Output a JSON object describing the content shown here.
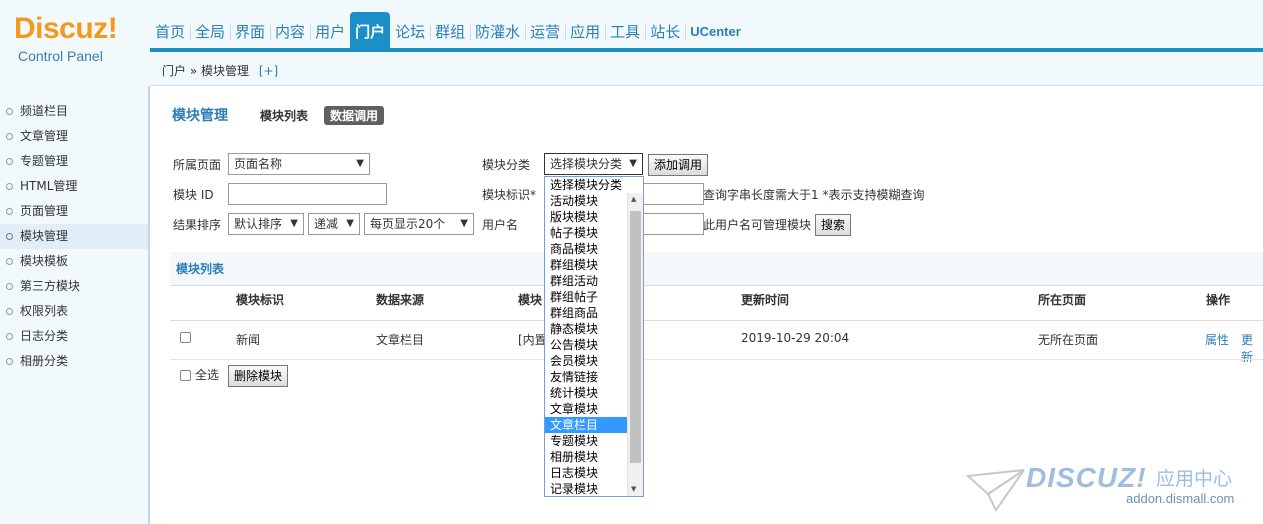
{
  "logo": {
    "main": "Discuz!",
    "sub": "Control Panel"
  },
  "nav": [
    "首页",
    "全局",
    "界面",
    "内容",
    "用户",
    "门户",
    "论坛",
    "群组",
    "防灌水",
    "运营",
    "应用",
    "工具",
    "站长",
    "UCenter"
  ],
  "nav_active": "门户",
  "breadcrumb": {
    "text": "门户 » 模块管理",
    "plus": "[+]"
  },
  "sidebar": {
    "items": [
      "频道栏目",
      "文章管理",
      "专题管理",
      "HTML管理",
      "页面管理",
      "模块管理",
      "模块模板",
      "第三方模块",
      "权限列表",
      "日志分类",
      "相册分类"
    ],
    "active": "模块管理"
  },
  "tabs": {
    "title": "模块管理",
    "list": "模块列表",
    "call": "数据调用"
  },
  "filters": {
    "page_label": "所属页面",
    "page_value": "页面名称",
    "id_label": "模块 ID",
    "sort_label": "结果排序",
    "sort_value": "默认排序",
    "order_value": "递减",
    "perpage_value": "每页显示20个",
    "category_label": "模块分类",
    "category_value": "选择模块分类",
    "add_button": "添加调用",
    "mark_label": "模块标识*",
    "mark_hint": "查询字串长度需大于1   *表示支持模糊查询",
    "user_label": "用户名",
    "user_hint": "此用户名可管理模块",
    "search_button": "搜索"
  },
  "list": {
    "title": "模块列表",
    "headers": [
      "模块标识",
      "数据来源",
      "模块",
      "更新时间",
      "所在页面",
      "操作"
    ],
    "rows": [
      {
        "mark": "新闻",
        "source": "文章栏目",
        "type": "[内置]",
        "updated": "2019-10-29 20:04",
        "page": "无所在页面",
        "op1": "属性",
        "op2": "更新"
      }
    ],
    "select_all": "全选",
    "delete_button": "删除模块"
  },
  "dropdown": {
    "options": [
      "选择模块分类",
      "活动模块",
      "版块模块",
      "帖子模块",
      "商品模块",
      "群组模块",
      "群组活动",
      "群组帖子",
      "群组商品",
      "静态模块",
      "公告模块",
      "会员模块",
      "友情链接",
      "统计模块",
      "文章模块",
      "文章栏目",
      "专题模块",
      "相册模块",
      "日志模块",
      "记录模块"
    ],
    "highlighted": "文章栏目"
  },
  "watermark": {
    "brand": "DISCUZ!",
    "cn": "应用中心",
    "url": "addon.dismall.com"
  },
  "colors": {
    "accent": "#1d8fc7",
    "link": "#2b7fb6",
    "logo": "#f39a1e",
    "sidebar_bg": "#f2f9fd"
  }
}
